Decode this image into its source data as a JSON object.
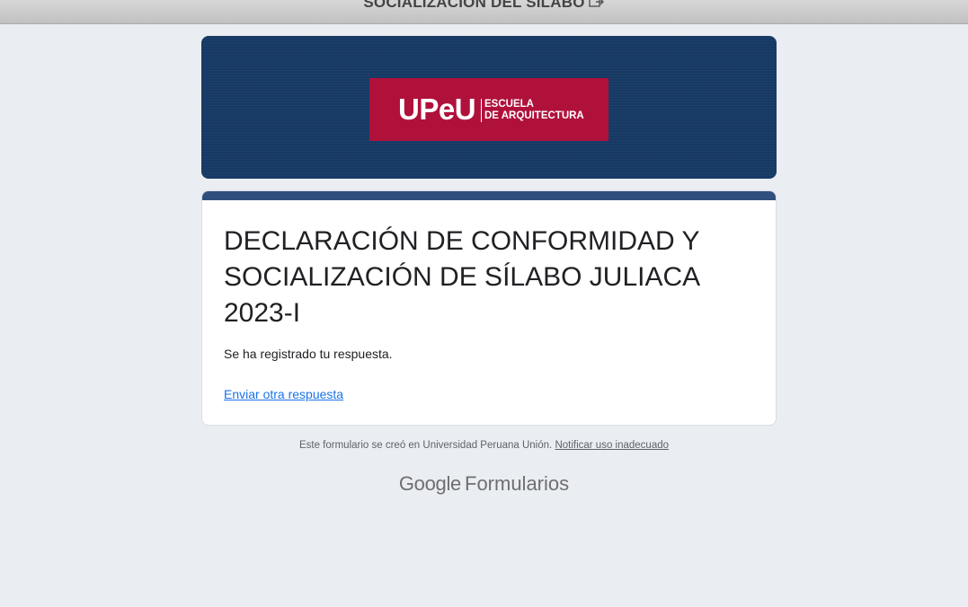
{
  "window": {
    "title": "SOCIALIZACION DEL SILABO",
    "icon": "external-link-icon"
  },
  "header": {
    "logo_main": "UPeU",
    "logo_line1": "ESCUELA",
    "logo_line2": "DE ARQUITECTURA",
    "background_color": "#173a64",
    "logo_color": "#b0113b"
  },
  "form": {
    "title": "DECLARACIÓN DE CONFORMIDAD Y SOCIALIZACIÓN DE SÍLABO JULIACA 2023-I",
    "confirmation": "Se ha registrado tu respuesta.",
    "submit_another": "Enviar otra respuesta",
    "accent_color": "#2f4f7f"
  },
  "footer": {
    "created_text": "Este formulario se creó en Universidad Peruana Unión.",
    "report_link": "Notificar uso inadecuado",
    "brand_google": "Google",
    "brand_product": "Formularios"
  }
}
